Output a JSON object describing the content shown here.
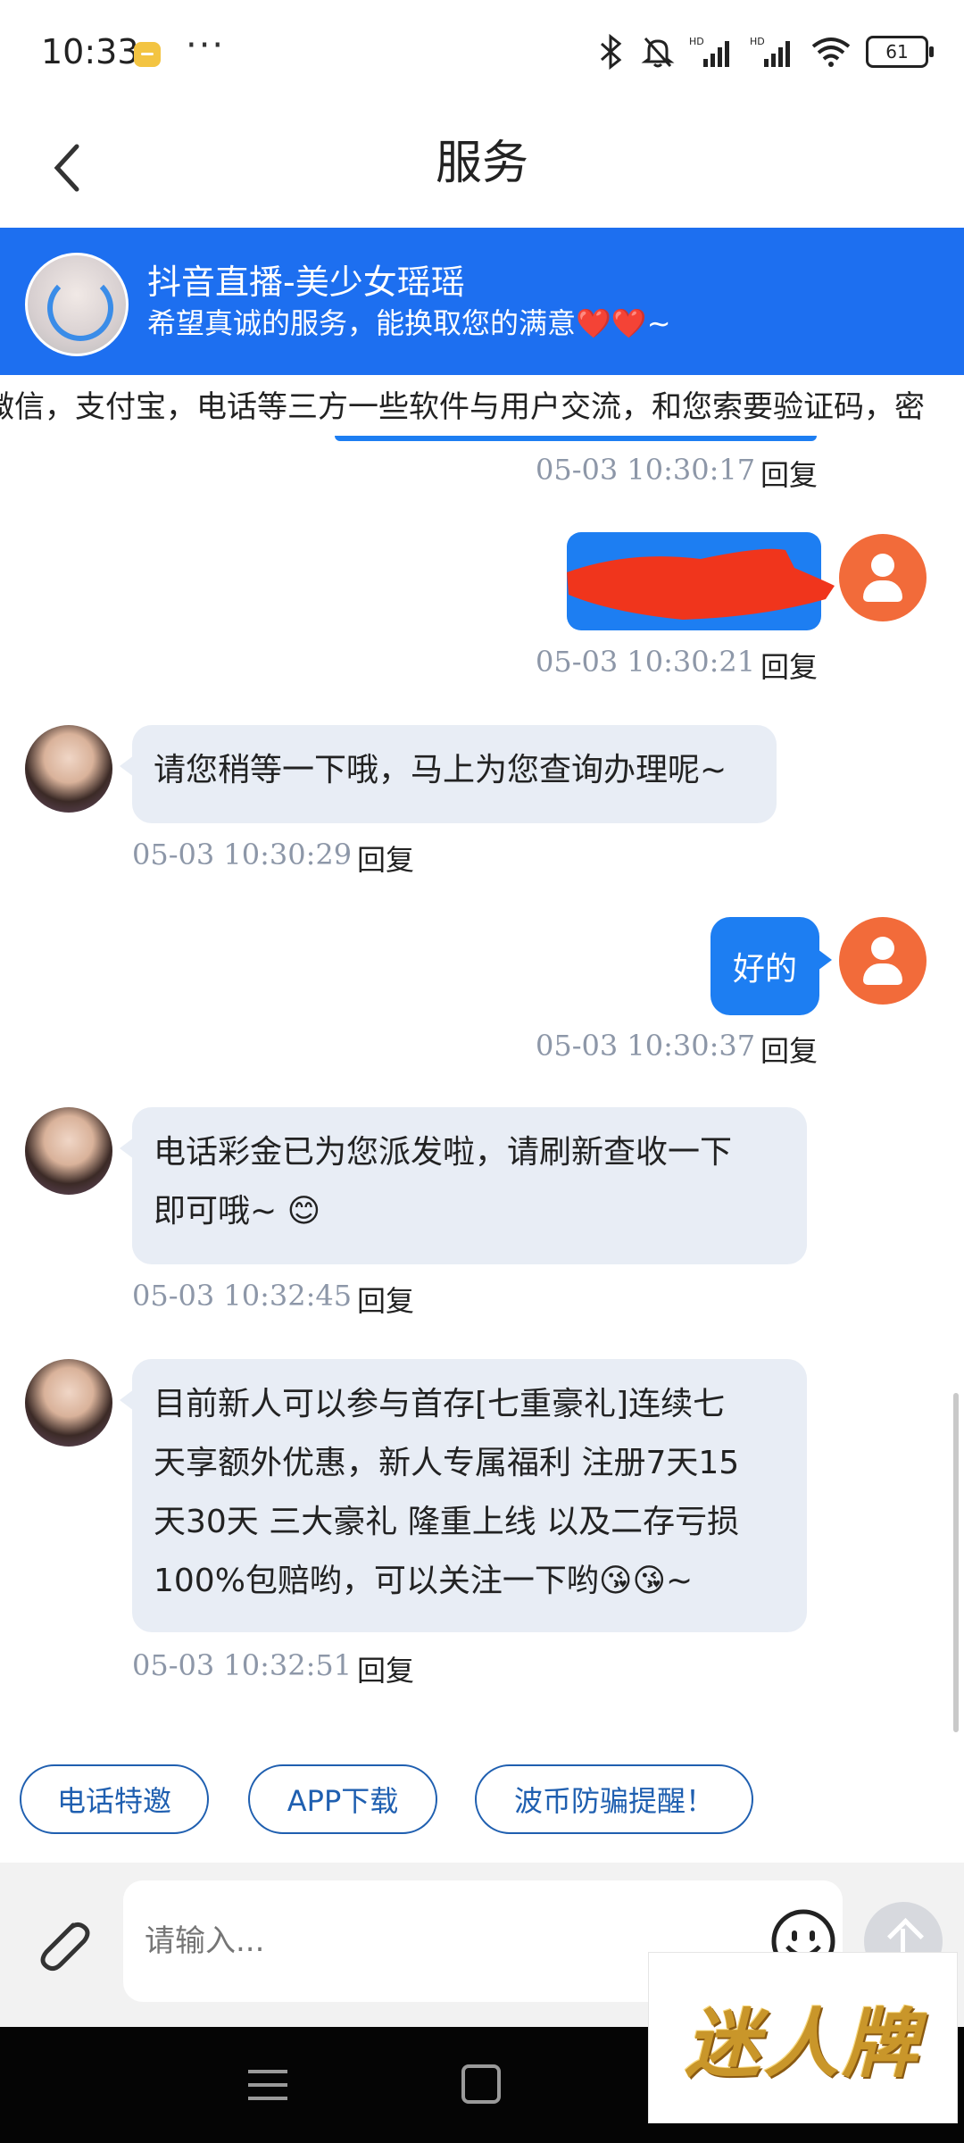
{
  "status_bar": {
    "time": "10:33",
    "dots": "···",
    "battery": "61",
    "icons": [
      "message-app-icon",
      "bluetooth-icon",
      "mute-bell-icon",
      "hd-signal-icon",
      "hd-signal-icon",
      "wifi-icon",
      "battery-icon"
    ]
  },
  "nav": {
    "title": "服务"
  },
  "banner": {
    "name": "抖音直播-美少女瑶瑶",
    "subtitle": "希望真诚的服务，能换取您的满意❤️❤️~"
  },
  "marquee": {
    "text": "微信，支付宝，电话等三方一些软件与用户交流，和您索要验证码，密"
  },
  "messages": [
    {
      "side": "out",
      "text": "",
      "time": "05-03 10:30:17",
      "reply": "回复"
    },
    {
      "side": "out",
      "text": "",
      "time": "05-03 10:30:21",
      "reply": "回复"
    },
    {
      "side": "in",
      "text": "请您稍等一下哦，马上为您查询办理呢~",
      "time": "05-03 10:30:29",
      "reply": "回复"
    },
    {
      "side": "out",
      "text": "好的",
      "time": "05-03 10:30:37",
      "reply": "回复"
    },
    {
      "side": "in",
      "lines": [
        "电话彩金已为您派发啦，请刷新查收一下",
        "即可哦~ 😊"
      ],
      "time": "05-03 10:32:45",
      "reply": "回复"
    },
    {
      "side": "in",
      "lines": [
        "目前新人可以参与首存[七重豪礼]连续七",
        "天享额外优惠，新人专属福利 注册7天15",
        "天30天 三大豪礼 隆重上线 以及二存亏损",
        "100%包赔哟，可以关注一下哟😘😘~"
      ],
      "time": "05-03 10:32:51",
      "reply": "回复"
    }
  ],
  "quick_actions": [
    "电话特邀",
    "APP下载",
    "波币防骗提醒！"
  ],
  "input": {
    "placeholder": "请输入..."
  },
  "watermark": {
    "text": "迷人牌"
  },
  "colors": {
    "accent": "#1d7ef2",
    "banner": "#1d6ff0",
    "user_avatar": "#f26b3a",
    "chip": "#1f5fb0",
    "incoming_bubble": "#e8edf5"
  }
}
